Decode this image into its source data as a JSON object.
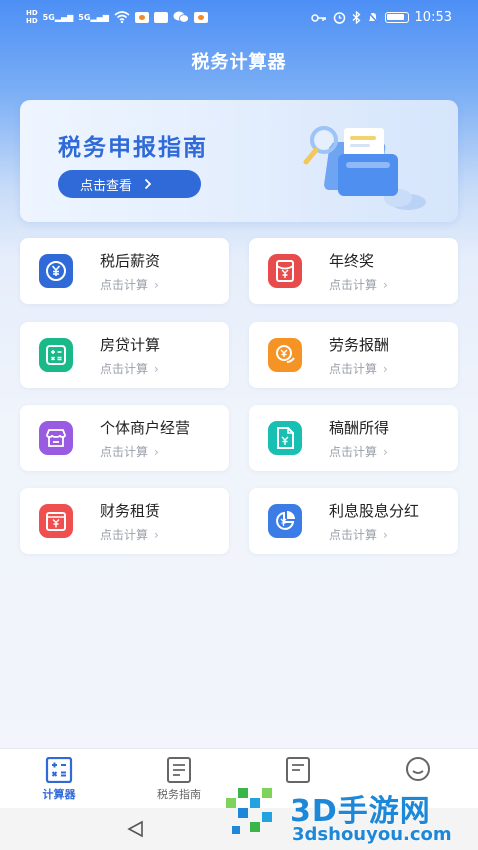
{
  "status_bar": {
    "hd_top": "HD",
    "hd_bottom": "HD",
    "signal1": "5G",
    "signal2": "5G",
    "time": "10:53"
  },
  "app": {
    "title": "税务计算器"
  },
  "banner": {
    "title": "税务申报指南",
    "button_label": "点击查看"
  },
  "cards": [
    {
      "label": "税后薪资",
      "sub": "点击计算",
      "icon": "yuan-coin-icon",
      "color": "#2f6ad8"
    },
    {
      "label": "年终奖",
      "sub": "点击计算",
      "icon": "red-envelope-icon",
      "color": "#e84b4b"
    },
    {
      "label": "房贷计算",
      "sub": "点击计算",
      "icon": "calculator-icon",
      "color": "#19b989"
    },
    {
      "label": "劳务报酬",
      "sub": "点击计算",
      "icon": "coin-hand-icon",
      "color": "#f59425"
    },
    {
      "label": "个体商户经营",
      "sub": "点击计算",
      "icon": "shop-icon",
      "color": "#9a5be3"
    },
    {
      "label": "稿酬所得",
      "sub": "点击计算",
      "icon": "document-yuan-icon",
      "color": "#18c0b4"
    },
    {
      "label": "财务租赁",
      "sub": "点击计算",
      "icon": "yuan-box-icon",
      "color": "#ef4f4f"
    },
    {
      "label": "利息股息分红",
      "sub": "点击计算",
      "icon": "pie-yuan-icon",
      "color": "#3b7ce6"
    }
  ],
  "tabs": [
    {
      "label": "计算器",
      "icon": "calculator-icon",
      "active": true
    },
    {
      "label": "税务指南",
      "icon": "document-icon",
      "active": false
    },
    {
      "label": "",
      "icon": "list-icon",
      "active": false
    },
    {
      "label": "",
      "icon": "chat-icon",
      "active": false
    }
  ],
  "watermark": {
    "brand": "3D手游网",
    "url": "3dshouyou.com"
  }
}
